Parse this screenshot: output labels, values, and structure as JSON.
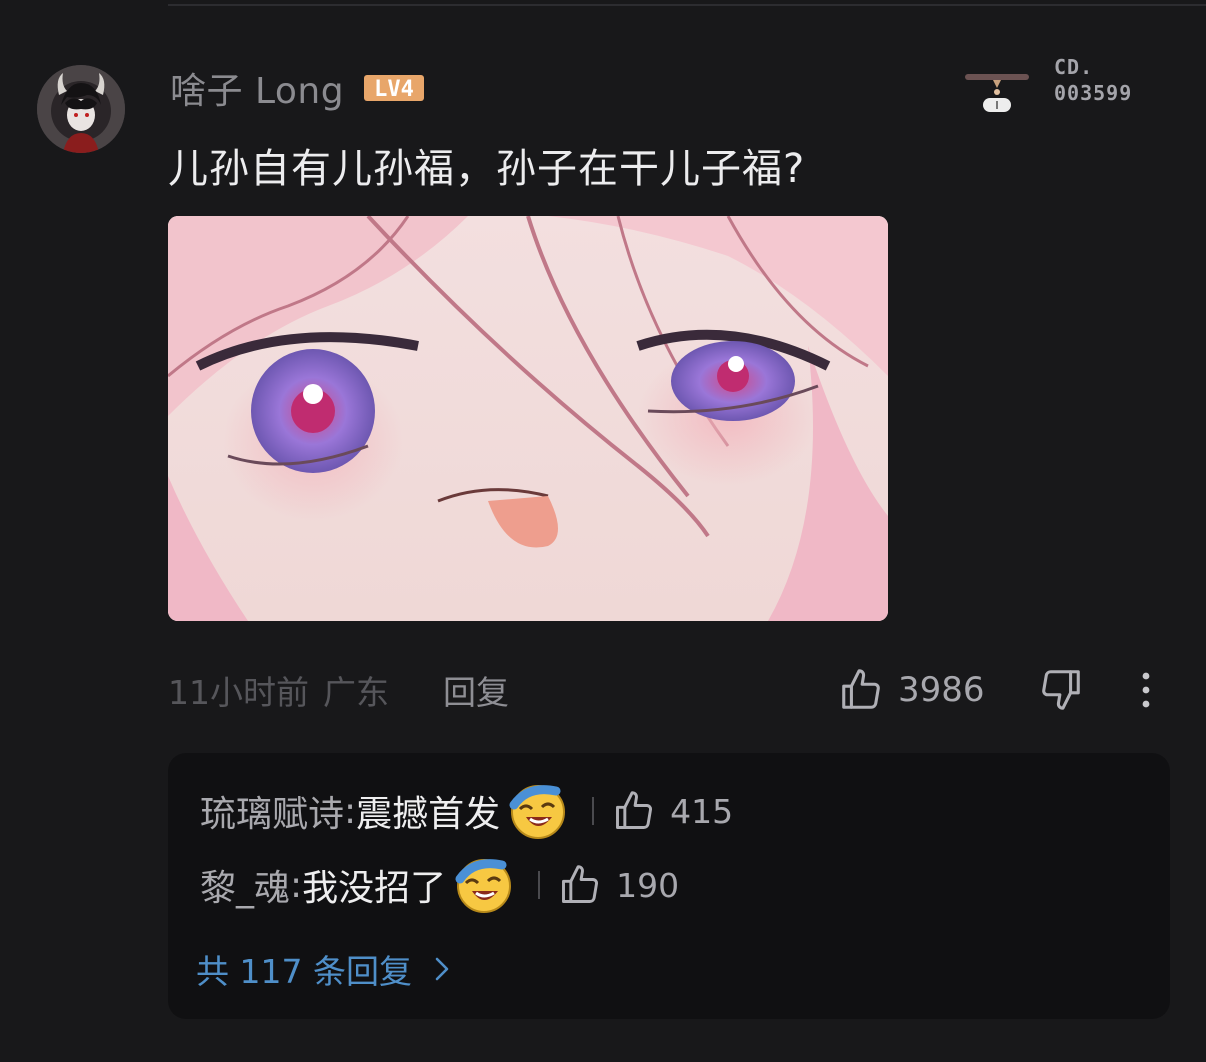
{
  "comment": {
    "username": "啥子 Long",
    "level": "LV4",
    "collection_label": "CD.",
    "collection_number": "003599",
    "text": "儿孙自有儿孙福，孙子在干儿子福?",
    "time": "11小时前",
    "location": "广东",
    "reply_label": "回复",
    "like_count": "3986"
  },
  "replies": [
    {
      "user": "琉璃赋诗",
      "sep": ": ",
      "text": "震撼首发",
      "emoji": "laughing-crying-emoji",
      "likes": "415"
    },
    {
      "user": "黎_魂",
      "sep": ": ",
      "text": "我没招了",
      "emoji": "laughing-crying-emoji",
      "likes": "190"
    }
  ],
  "view_all_replies": "共 117 条回复",
  "icons": {
    "like": "thumbs-up-icon",
    "dislike": "thumbs-down-icon",
    "more": "more-vertical-icon",
    "chevron": "chevron-right-icon"
  },
  "colors": {
    "background": "#18181a",
    "reply_box": "#101012",
    "link_blue": "#4f8fc9",
    "level_badge": "#e8a66a"
  }
}
